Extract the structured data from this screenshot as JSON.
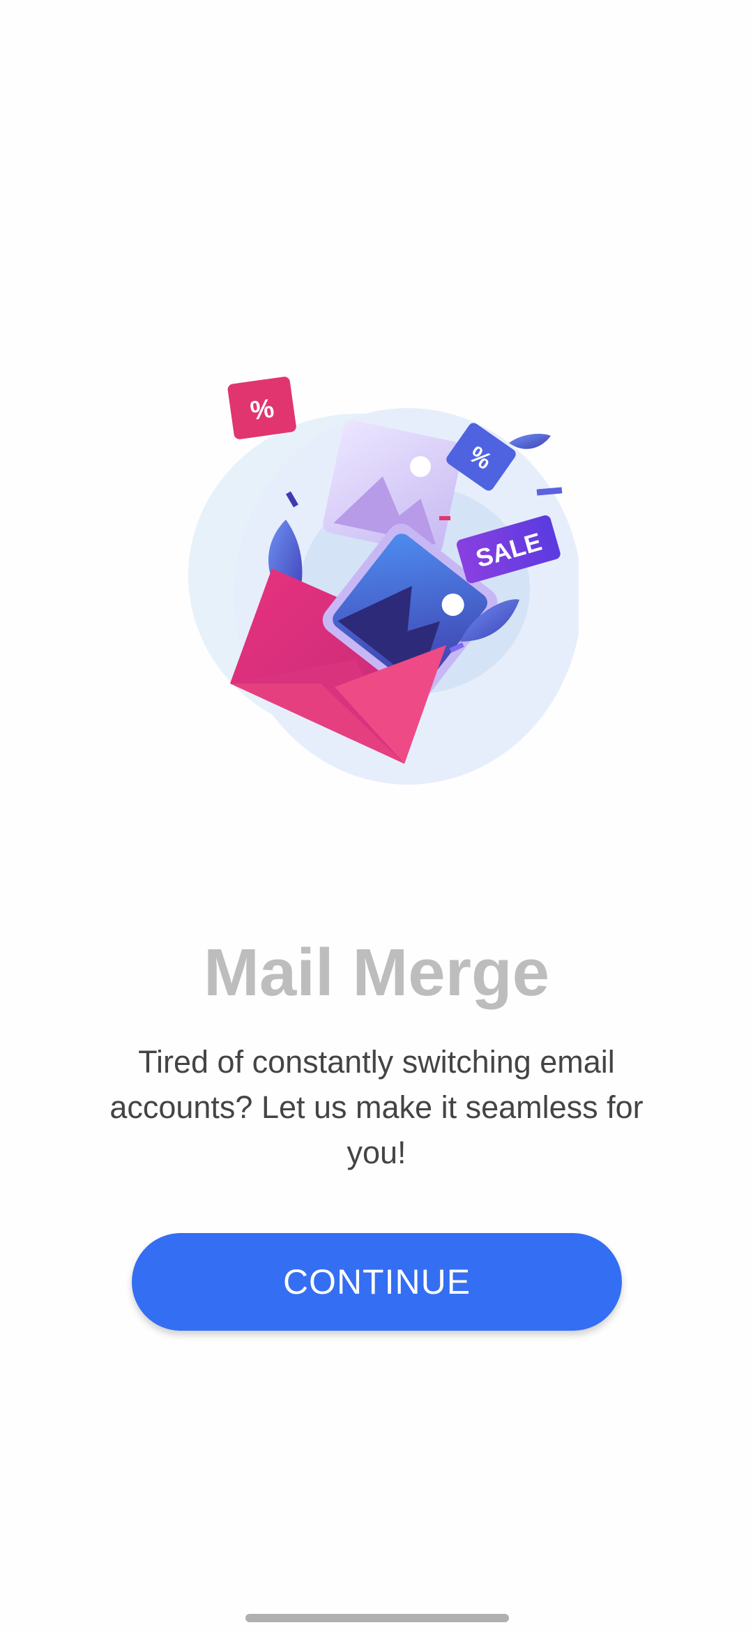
{
  "onboarding": {
    "title": "Mail Merge",
    "subtitle": "Tired of constantly switching email accounts? Let us make it seamless for you!",
    "continue_label": "CONTINUE",
    "illustration": {
      "icon": "envelope-sale-illustration",
      "tag_symbol_1": "%",
      "tag_symbol_2": "%",
      "sale_label": "SALE"
    }
  },
  "colors": {
    "accent": "#346ef2",
    "title_gray": "#bdbdbd",
    "body_text": "#444444",
    "envelope_pink": "#e63b7f"
  }
}
